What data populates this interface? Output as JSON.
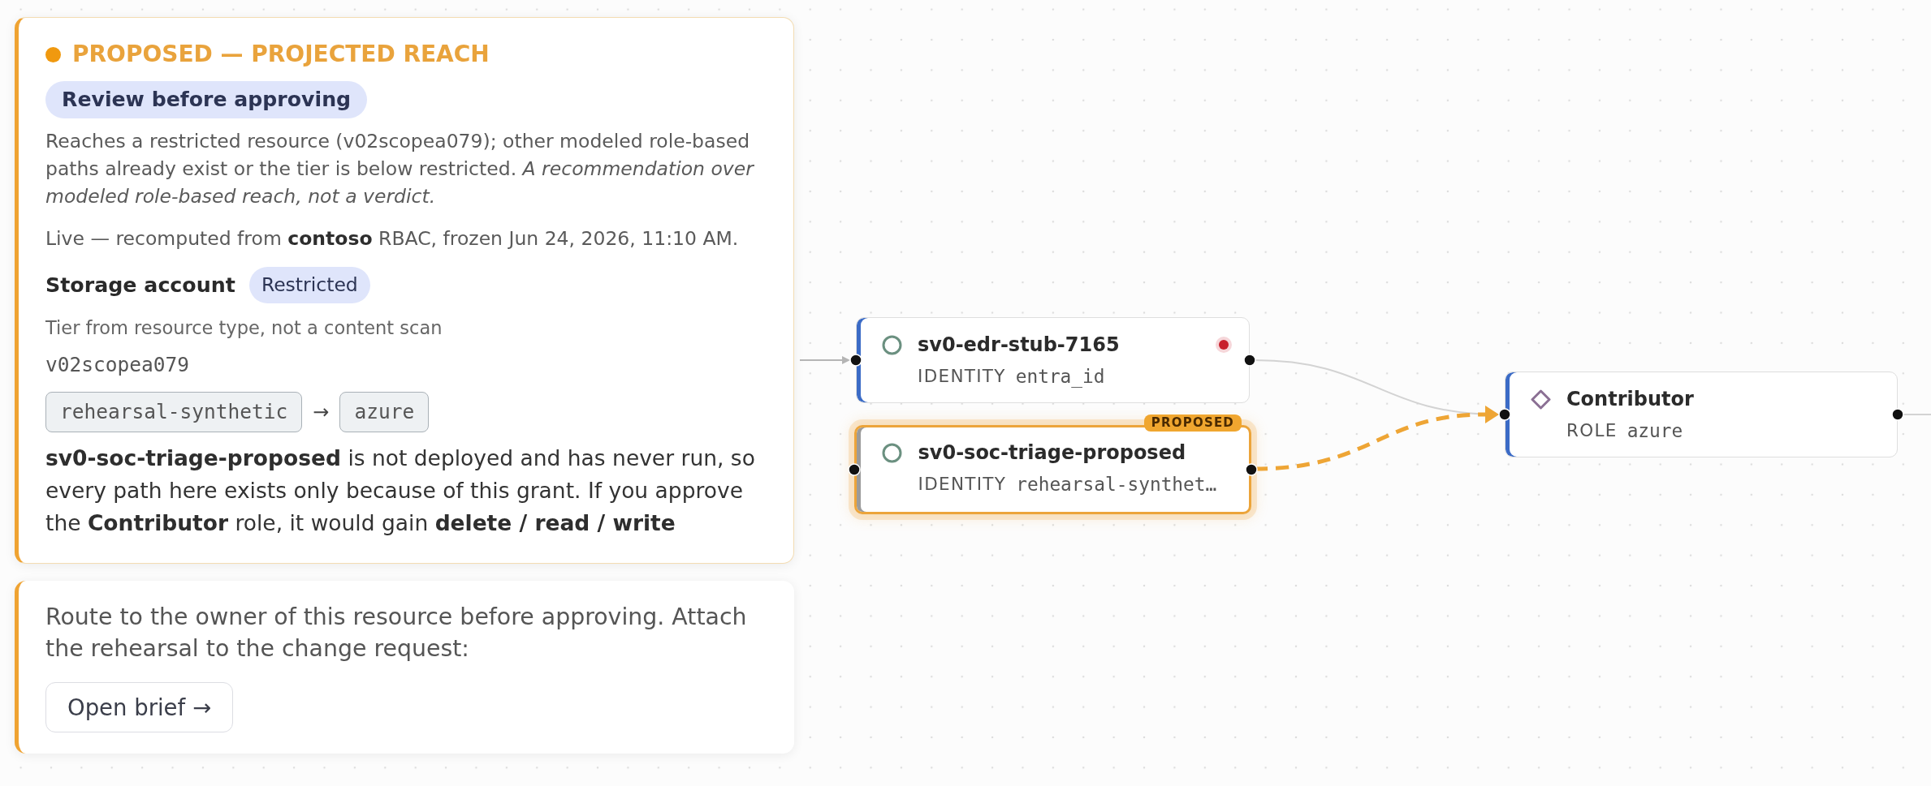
{
  "detail_panel": {
    "status": {
      "kind": "proposed",
      "label": "PROPOSED — PROJECTED REACH"
    },
    "verdict": "Review before approving",
    "summary": "Reaches a restricted resource (v02scopea079); other modeled role-based paths already exist or the tier is below restricted. *A recommendation over modeled role-based reach, not a verdict.*",
    "provenance": "Live — recomputed from **contoso** RBAC, frozen Jun 24, 2026, 11:10 AM.",
    "resource": {
      "type": "Storage account",
      "tier": "Restricted",
      "tier_note": "Tier from resource type, not a content scan",
      "name": "v02scopea079"
    },
    "path": [
      "rehearsal-synthetic",
      "azure"
    ],
    "path_separator": "→",
    "explanation": "**sv0-soc-triage-proposed** is not deployed and has never run, so every path here exists only because of this grant. If you approve the **Contributor** role, it would gain **delete / read / write**"
  },
  "action_card": {
    "text": "Route to the owner of this resource before approving. Attach the rehearsal to the change request:",
    "button": "Open brief →"
  },
  "graph": {
    "nodes": [
      {
        "kind": "identity",
        "name": "sv0-edr-stub-7165",
        "type": "IDENTITY",
        "source": "entra_id",
        "deployed": true,
        "proposed": false,
        "alert": true
      },
      {
        "kind": "identity",
        "name": "sv0-soc-triage-proposed",
        "type": "IDENTITY",
        "source": "rehearsal-synthet…",
        "badge": "PROPOSED",
        "deployed": false,
        "proposed": true,
        "alert": false
      },
      {
        "kind": "role",
        "name": "Contributor",
        "type": "ROLE",
        "source": "azure",
        "deployed": true,
        "proposed": false,
        "alert": false
      }
    ],
    "edges": [
      {
        "kind": "arrow"
      },
      {
        "kind": "line"
      },
      {
        "kind": "dashed-arrow"
      },
      {
        "kind": "line"
      }
    ]
  }
}
